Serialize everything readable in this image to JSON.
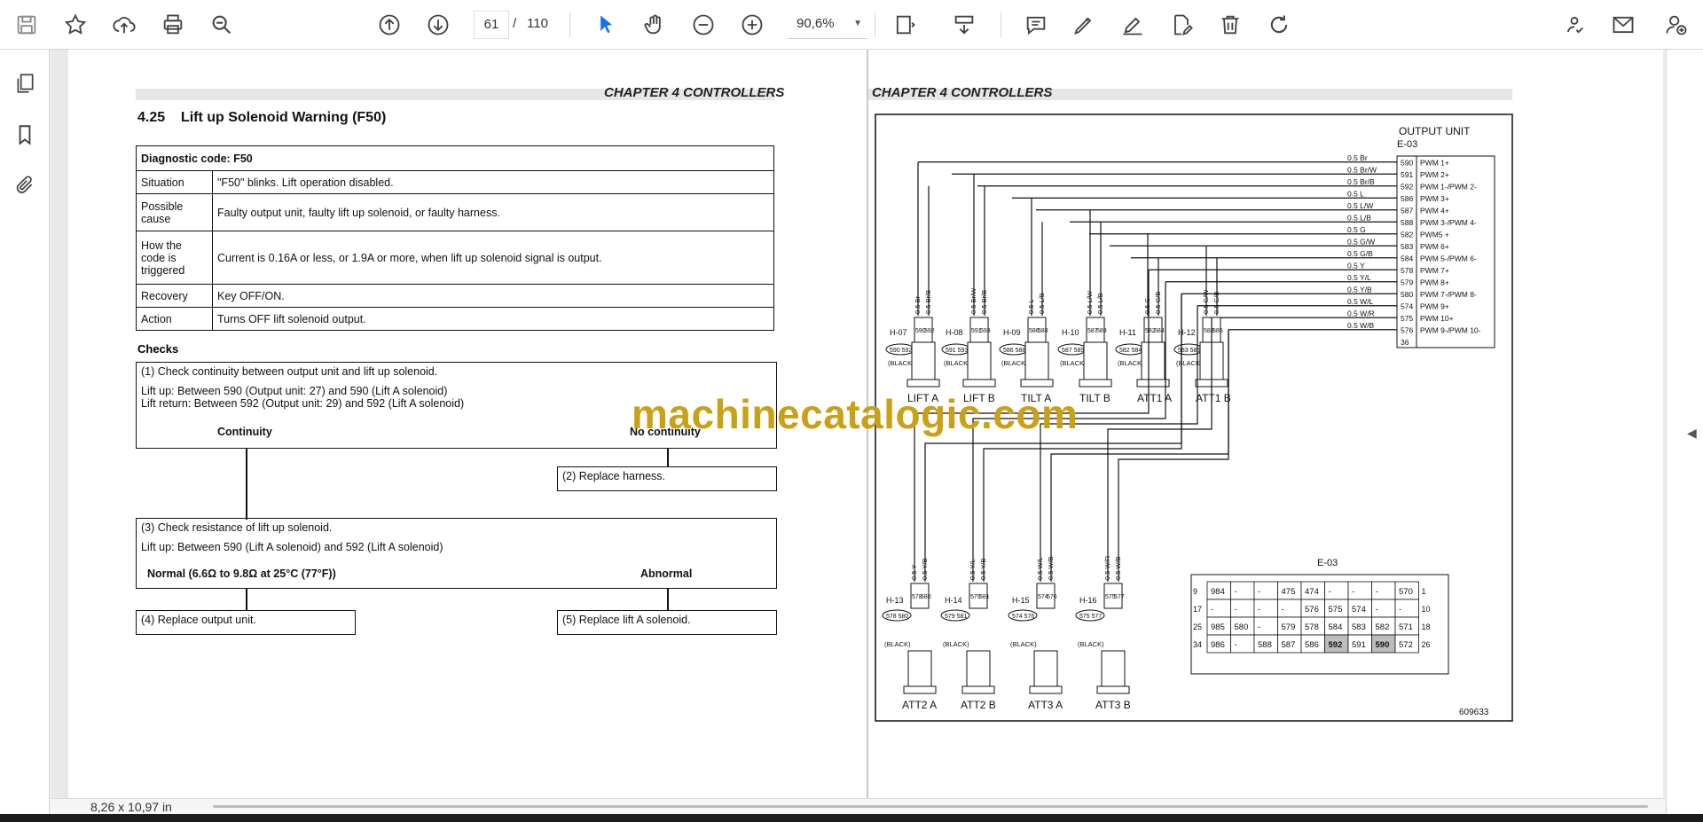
{
  "toolbar": {
    "page_current": "61",
    "page_sep": "/",
    "page_total": "110",
    "zoom": "90,6%",
    "icons": [
      "save-icon",
      "star-icon",
      "upload-cloud-icon",
      "print-icon",
      "zoom-search-icon",
      "page-up-icon",
      "page-down-icon",
      "select-cursor-icon",
      "hand-pan-icon",
      "zoom-out-icon",
      "zoom-in-icon",
      "fit-page-icon",
      "scroll-mode-icon",
      "comment-icon",
      "pen-icon",
      "sign-icon",
      "edit-pdf-icon",
      "delete-icon",
      "rotate-icon",
      "share-link-icon",
      "email-icon",
      "add-user-icon"
    ],
    "accent": "#1473e6"
  },
  "left_rail": {
    "icons": [
      "pages-icon",
      "bookmark-icon",
      "attachment-icon"
    ]
  },
  "status": {
    "size": "8,26 x 10,97 in"
  },
  "watermark": "machinecatalogic.com",
  "left_page": {
    "chapter": "CHAPTER 4 CONTROLLERS",
    "section": "4.25    Lift up Solenoid Warning (F50)",
    "diag_header": "Diagnostic code: F50",
    "rows": [
      {
        "label": "Situation",
        "value": "\"F50\" blinks. Lift operation disabled."
      },
      {
        "label": "Possible cause",
        "value": "Faulty output unit, faulty lift up solenoid, or faulty harness."
      },
      {
        "label": "How the code is triggered",
        "value": "Current is 0.16A or less, or 1.9A or more, when lift up solenoid signal is output."
      },
      {
        "label": "Recovery",
        "value": "Key OFF/ON."
      },
      {
        "label": "Action",
        "value": "Turns OFF lift solenoid output."
      }
    ],
    "checks_title": "Checks",
    "step1": {
      "title": "(1) Check continuity between output unit and lift up solenoid.",
      "line1": "Lift up: Between 590 (Output unit: 27) and 590 (Lift A solenoid)",
      "line2": "Lift return: Between 592 (Output unit: 29) and 592 (Lift A solenoid)",
      "yes": "Continuity",
      "no": "No continuity"
    },
    "step2": "(2) Replace harness.",
    "step3": {
      "title": "(3) Check resistance of lift up solenoid.",
      "line1": "Lift up: Between 590 (Lift A solenoid) and 592 (Lift A solenoid)",
      "yes": "Normal (6.6Ω to 9.8Ω at 25°C (77°F))",
      "no": "Abnormal"
    },
    "step4": "(4) Replace output unit.",
    "step5": "(5) Replace lift A solenoid."
  },
  "right_page": {
    "chapter": "CHAPTER 4 CONTROLLERS",
    "output_unit": "OUTPUT UNIT",
    "connector": "E-03",
    "figure_no": "609633",
    "pins": [
      {
        "wire": "0.5 Br",
        "pin": "590",
        "func": "PWM 1+"
      },
      {
        "wire": "0.5 Br/W",
        "pin": "591",
        "func": "PWM 2+"
      },
      {
        "wire": "0.5 Br/B",
        "pin": "592",
        "func": "PWM 1-/PWM 2-"
      },
      {
        "wire": "0.5 L",
        "pin": "586",
        "func": "PWM 3+"
      },
      {
        "wire": "0.5 L/W",
        "pin": "587",
        "func": "PWM 4+"
      },
      {
        "wire": "0.5 L/B",
        "pin": "588",
        "func": "PWM 3-/PWM 4-"
      },
      {
        "wire": "0.5 G",
        "pin": "582",
        "func": "PWM5 +"
      },
      {
        "wire": "0.5 G/W",
        "pin": "583",
        "func": "PWM 6+"
      },
      {
        "wire": "0.5 G/B",
        "pin": "584",
        "func": "PWM 5-/PWM 6-"
      },
      {
        "wire": "0.5 Y",
        "pin": "578",
        "func": "PWM 7+"
      },
      {
        "wire": "0.5 Y/L",
        "pin": "579",
        "func": "PWM 8+"
      },
      {
        "wire": "0.5 Y/B",
        "pin": "580",
        "func": "PWM 7-/PWM 8-"
      },
      {
        "wire": "0.5 W/L",
        "pin": "574",
        "func": "PWM 9+"
      },
      {
        "wire": "0.5 W/R",
        "pin": "575",
        "func": "PWM 10+"
      },
      {
        "wire": "0.5 W/B",
        "pin": "576",
        "func": "PWM 9-/PWM 10-"
      },
      {
        "wire": "",
        "pin": "36",
        "func": ""
      }
    ],
    "top_solenoids": [
      {
        "conn": "H-07",
        "a": "590",
        "b": "592",
        "name": "LIFT A",
        "w1": "0.5 Br",
        "w2": "0.5 Br/B"
      },
      {
        "conn": "H-08",
        "a": "591",
        "b": "593",
        "name": "LIFT B",
        "w1": "0.5 Br/W",
        "w2": "0.5 Br/B"
      },
      {
        "conn": "H-09",
        "a": "586",
        "b": "588",
        "name": "TILT A",
        "w1": "0.5 L",
        "w2": "0.5 L/B"
      },
      {
        "conn": "H-10",
        "a": "587",
        "b": "589",
        "name": "TILT B",
        "w1": "0.5 L/W",
        "w2": "0.5 L/B"
      },
      {
        "conn": "H-11",
        "a": "582",
        "b": "584",
        "name": "ATT1 A",
        "w1": "0.5 G",
        "w2": "0.5 G/B"
      },
      {
        "conn": "H-12",
        "a": "583",
        "b": "585",
        "name": "ATT1 B",
        "w1": "0.5 G/W",
        "w2": "0.5 G/B"
      }
    ],
    "bottom_solenoids": [
      {
        "conn": "H-13",
        "a": "578",
        "b": "580",
        "name": "ATT2 A",
        "w1": "0.5 Y",
        "w2": "0.5 Y/B"
      },
      {
        "conn": "H-14",
        "a": "579",
        "b": "581",
        "name": "ATT2 B",
        "w1": "0.5 Y/L",
        "w2": "0.5 Y/B"
      },
      {
        "conn": "H-15",
        "a": "574",
        "b": "576",
        "name": "ATT3 A",
        "w1": "0.5 W/L",
        "w2": "0.5 W/B"
      },
      {
        "conn": "H-16",
        "a": "575",
        "b": "577",
        "name": "ATT3 B",
        "w1": "0.5 W/R",
        "w2": "0.5 W/B"
      }
    ],
    "black": "(BLACK)",
    "e03_grid": {
      "rows": [
        {
          "left": "9",
          "cells": [
            "984",
            "-",
            "-",
            "475",
            "474",
            "-",
            "-",
            "-",
            "570"
          ],
          "right": "1"
        },
        {
          "left": "17",
          "cells": [
            "-",
            "-",
            "-",
            "-",
            "576",
            "575",
            "574",
            "-",
            "-"
          ],
          "right": "10"
        },
        {
          "left": "25",
          "cells": [
            "985",
            "580",
            "-",
            "579",
            "578",
            "584",
            "583",
            "582",
            "571"
          ],
          "right": "18"
        },
        {
          "left": "34",
          "cells": [
            "986",
            "-",
            "588",
            "587",
            "586",
            "592",
            "591",
            "590",
            "572"
          ],
          "right": "26"
        }
      ],
      "highlight": [
        "592",
        "590"
      ]
    }
  }
}
